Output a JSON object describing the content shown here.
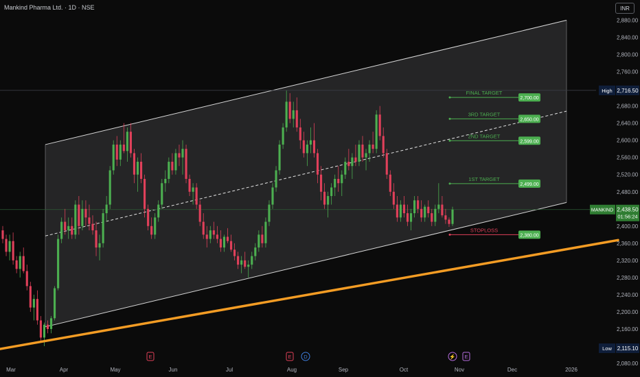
{
  "header": {
    "title": "Mankind Pharma Ltd. · 1D · NSE",
    "currency": "INR"
  },
  "colors": {
    "background": "#0b0b0b",
    "up": "#4caf50",
    "down": "#e0405a",
    "channel_fill": "#2a2a2b",
    "channel_line": "#d8d8d8",
    "trendline": "#f39c24",
    "target_green": "#4caf50",
    "stop_red": "#e0405a",
    "axis_text": "#b2b5be",
    "high_low_bg": "#0f1e3a"
  },
  "chart_data": {
    "type": "candlestick",
    "symbol": "MANKIND",
    "ylim": [
      2080,
      2900
    ],
    "x_tick_labels": [
      "Mar",
      "Apr",
      "May",
      "Jun",
      "Jul",
      "Aug",
      "Sep",
      "Oct",
      "Nov",
      "Dec",
      "2026"
    ],
    "y_tick_labels": [
      "2,880.00",
      "2,840.00",
      "2,800.00",
      "2,760.00",
      "2,720.00",
      "2,680.00",
      "2,640.00",
      "2,600.00",
      "2,560.00",
      "2,520.00",
      "2,480.00",
      "2,440.00",
      "2,400.00",
      "2,360.00",
      "2,320.00",
      "2,280.00",
      "2,240.00",
      "2,200.00",
      "2,160.00",
      "2,120.00",
      "2,080.00"
    ],
    "targets": [
      {
        "label": "FINAL TARGET",
        "value": "2,700.00",
        "price": 2700
      },
      {
        "label": "3RD TARGET",
        "value": "2,650.00",
        "price": 2650
      },
      {
        "label": "2ND TARGET",
        "value": "2,599.00",
        "price": 2599
      },
      {
        "label": "1ST TARGET",
        "value": "2,499.00",
        "price": 2499
      }
    ],
    "stoploss": {
      "label": "STOPLOSS",
      "value": "2,380.00",
      "price": 2380
    },
    "high": {
      "label": "High",
      "value": "2,716.50",
      "price": 2716.5
    },
    "low": {
      "label": "Low",
      "value": "2,115.10",
      "price": 2115.1
    },
    "last": {
      "label": "MANKIND",
      "value": "2,438.50",
      "countdown": "01:56:24",
      "price": 2438.5
    },
    "events": [
      {
        "icon": "E",
        "kind": "earnings",
        "month": "May"
      },
      {
        "icon": "E",
        "kind": "earnings",
        "month": "Aug"
      },
      {
        "icon": "D",
        "kind": "dividend",
        "month": "Aug"
      },
      {
        "icon": "⚡",
        "kind": "split",
        "month": "Oct"
      },
      {
        "icon": "E",
        "kind": "earnings",
        "month": "Oct"
      }
    ],
    "channel": {
      "upper_start": {
        "month": "Mar",
        "price": 2590
      },
      "upper_end": {
        "month": "Dec",
        "price": 2880
      },
      "lower_start": {
        "month": "Mar",
        "price": 2165
      },
      "lower_end": {
        "month": "Dec",
        "price": 2455
      },
      "mid_start": {
        "month": "Mar",
        "price": 2377
      },
      "mid_end": {
        "month": "Dec",
        "price": 2668
      }
    },
    "trendline": {
      "start": {
        "month": "Feb",
        "price": 2112
      },
      "end": {
        "month": "Dec",
        "price": 2372
      }
    },
    "candles_ohlc": [
      [
        2390,
        2400,
        2360,
        2370
      ],
      [
        2370,
        2380,
        2330,
        2340
      ],
      [
        2340,
        2380,
        2320,
        2365
      ],
      [
        2365,
        2385,
        2310,
        2320
      ],
      [
        2320,
        2330,
        2290,
        2300
      ],
      [
        2300,
        2340,
        2280,
        2330
      ],
      [
        2330,
        2350,
        2290,
        2295
      ],
      [
        2295,
        2310,
        2250,
        2260
      ],
      [
        2260,
        2270,
        2200,
        2210
      ],
      [
        2210,
        2240,
        2180,
        2230
      ],
      [
        2230,
        2250,
        2170,
        2180
      ],
      [
        2180,
        2190,
        2130,
        2140
      ],
      [
        2140,
        2175,
        2120,
        2170
      ],
      [
        2170,
        2180,
        2150,
        2160
      ],
      [
        2160,
        2190,
        2150,
        2185
      ],
      [
        2185,
        2260,
        2180,
        2255
      ],
      [
        2255,
        2380,
        2250,
        2370
      ],
      [
        2370,
        2420,
        2360,
        2410
      ],
      [
        2410,
        2440,
        2380,
        2390
      ],
      [
        2390,
        2420,
        2370,
        2400
      ],
      [
        2400,
        2420,
        2370,
        2380
      ],
      [
        2380,
        2460,
        2370,
        2450
      ],
      [
        2450,
        2470,
        2380,
        2400
      ],
      [
        2400,
        2460,
        2390,
        2440
      ],
      [
        2440,
        2460,
        2400,
        2420
      ],
      [
        2420,
        2450,
        2390,
        2405
      ],
      [
        2405,
        2425,
        2380,
        2390
      ],
      [
        2390,
        2410,
        2330,
        2350
      ],
      [
        2350,
        2380,
        2320,
        2360
      ],
      [
        2360,
        2440,
        2350,
        2430
      ],
      [
        2430,
        2470,
        2410,
        2450
      ],
      [
        2450,
        2540,
        2440,
        2530
      ],
      [
        2530,
        2600,
        2520,
        2590
      ],
      [
        2590,
        2610,
        2540,
        2555
      ],
      [
        2555,
        2600,
        2540,
        2590
      ],
      [
        2590,
        2640,
        2570,
        2575
      ],
      [
        2575,
        2630,
        2550,
        2620
      ],
      [
        2620,
        2640,
        2560,
        2570
      ],
      [
        2570,
        2580,
        2500,
        2520
      ],
      [
        2520,
        2560,
        2480,
        2550
      ],
      [
        2550,
        2570,
        2500,
        2510
      ],
      [
        2510,
        2520,
        2420,
        2440
      ],
      [
        2440,
        2450,
        2390,
        2400
      ],
      [
        2400,
        2420,
        2370,
        2380
      ],
      [
        2380,
        2430,
        2370,
        2420
      ],
      [
        2420,
        2460,
        2410,
        2450
      ],
      [
        2450,
        2510,
        2440,
        2500
      ],
      [
        2500,
        2530,
        2480,
        2510
      ],
      [
        2510,
        2560,
        2500,
        2550
      ],
      [
        2550,
        2570,
        2520,
        2530
      ],
      [
        2530,
        2580,
        2520,
        2570
      ],
      [
        2570,
        2590,
        2540,
        2560
      ],
      [
        2560,
        2600,
        2520,
        2580
      ],
      [
        2580,
        2590,
        2500,
        2510
      ],
      [
        2510,
        2520,
        2470,
        2480
      ],
      [
        2480,
        2500,
        2450,
        2490
      ],
      [
        2490,
        2500,
        2440,
        2450
      ],
      [
        2450,
        2460,
        2400,
        2410
      ],
      [
        2410,
        2430,
        2370,
        2380
      ],
      [
        2380,
        2400,
        2350,
        2370
      ],
      [
        2370,
        2400,
        2360,
        2390
      ],
      [
        2390,
        2410,
        2370,
        2380
      ],
      [
        2380,
        2400,
        2360,
        2370
      ],
      [
        2370,
        2390,
        2340,
        2350
      ],
      [
        2350,
        2380,
        2340,
        2375
      ],
      [
        2375,
        2395,
        2360,
        2365
      ],
      [
        2365,
        2380,
        2340,
        2345
      ],
      [
        2345,
        2360,
        2320,
        2330
      ],
      [
        2330,
        2340,
        2300,
        2310
      ],
      [
        2310,
        2330,
        2290,
        2320
      ],
      [
        2320,
        2340,
        2300,
        2305
      ],
      [
        2305,
        2320,
        2280,
        2310
      ],
      [
        2310,
        2340,
        2300,
        2330
      ],
      [
        2330,
        2360,
        2320,
        2350
      ],
      [
        2350,
        2390,
        2340,
        2380
      ],
      [
        2380,
        2400,
        2350,
        2360
      ],
      [
        2360,
        2420,
        2350,
        2410
      ],
      [
        2410,
        2460,
        2400,
        2450
      ],
      [
        2450,
        2500,
        2440,
        2490
      ],
      [
        2490,
        2540,
        2480,
        2530
      ],
      [
        2530,
        2600,
        2520,
        2590
      ],
      [
        2590,
        2640,
        2580,
        2630
      ],
      [
        2630,
        2716,
        2620,
        2690
      ],
      [
        2690,
        2710,
        2640,
        2650
      ],
      [
        2650,
        2690,
        2630,
        2670
      ],
      [
        2670,
        2700,
        2620,
        2630
      ],
      [
        2630,
        2650,
        2580,
        2600
      ],
      [
        2600,
        2620,
        2560,
        2570
      ],
      [
        2570,
        2600,
        2540,
        2590
      ],
      [
        2590,
        2630,
        2570,
        2600
      ],
      [
        2600,
        2640,
        2560,
        2570
      ],
      [
        2570,
        2580,
        2500,
        2520
      ],
      [
        2520,
        2540,
        2460,
        2480
      ],
      [
        2480,
        2500,
        2440,
        2450
      ],
      [
        2450,
        2480,
        2420,
        2470
      ],
      [
        2470,
        2500,
        2450,
        2490
      ],
      [
        2490,
        2520,
        2470,
        2510
      ],
      [
        2510,
        2540,
        2480,
        2500
      ],
      [
        2500,
        2530,
        2470,
        2520
      ],
      [
        2520,
        2560,
        2510,
        2550
      ],
      [
        2550,
        2580,
        2530,
        2540
      ],
      [
        2540,
        2570,
        2510,
        2560
      ],
      [
        2560,
        2590,
        2540,
        2550
      ],
      [
        2550,
        2600,
        2540,
        2590
      ],
      [
        2590,
        2610,
        2550,
        2560
      ],
      [
        2560,
        2580,
        2530,
        2570
      ],
      [
        2570,
        2600,
        2550,
        2590
      ],
      [
        2590,
        2620,
        2570,
        2580
      ],
      [
        2580,
        2670,
        2570,
        2660
      ],
      [
        2660,
        2680,
        2600,
        2610
      ],
      [
        2610,
        2630,
        2560,
        2570
      ],
      [
        2570,
        2580,
        2510,
        2520
      ],
      [
        2520,
        2530,
        2470,
        2480
      ],
      [
        2480,
        2500,
        2440,
        2450
      ],
      [
        2450,
        2470,
        2410,
        2420
      ],
      [
        2420,
        2460,
        2410,
        2450
      ],
      [
        2450,
        2470,
        2420,
        2430
      ],
      [
        2430,
        2450,
        2400,
        2410
      ],
      [
        2410,
        2440,
        2390,
        2430
      ],
      [
        2430,
        2470,
        2420,
        2460
      ],
      [
        2460,
        2470,
        2430,
        2440
      ],
      [
        2440,
        2460,
        2410,
        2420
      ],
      [
        2420,
        2450,
        2410,
        2445
      ],
      [
        2445,
        2460,
        2420,
        2430
      ],
      [
        2430,
        2440,
        2400,
        2410
      ],
      [
        2410,
        2450,
        2400,
        2440
      ],
      [
        2440,
        2500,
        2430,
        2450
      ],
      [
        2450,
        2470,
        2420,
        2425
      ],
      [
        2425,
        2440,
        2405,
        2415
      ],
      [
        2415,
        2420,
        2398,
        2405
      ],
      [
        2405,
        2445,
        2400,
        2438.5
      ]
    ]
  }
}
